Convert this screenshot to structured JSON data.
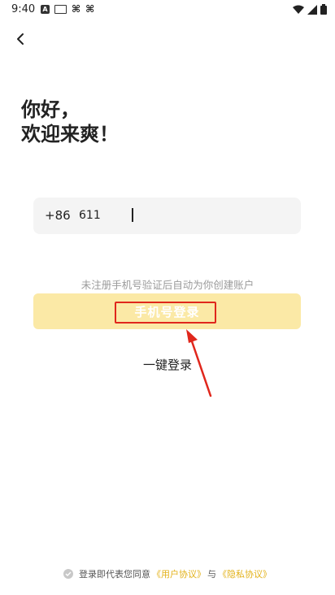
{
  "status_bar": {
    "time": "9:40",
    "icons_left": [
      "a-icon",
      "keyboard-icon",
      "bug-icon",
      "bug-icon"
    ],
    "icons_right": [
      "wifi-icon",
      "signal-icon",
      "battery-icon"
    ]
  },
  "header": {
    "back_icon": "chevron-left-icon"
  },
  "greeting": {
    "line1": "你好，",
    "line2": "欢迎来爽！"
  },
  "phone": {
    "country_code": "+86",
    "value": "611"
  },
  "hint": "未注册手机号验证后自动为你创建账户",
  "login_button": {
    "label": "手机号登录",
    "bg_color": "#fbe9a6"
  },
  "one_key_login": "一键登录",
  "annotation": {
    "color": "#e0271c"
  },
  "agreement": {
    "prefix": "登录即代表您同意",
    "user_agreement": "《用户协议》",
    "conjunction": "与",
    "privacy_agreement": "《隐私协议》",
    "link_color": "#e3b21a"
  }
}
